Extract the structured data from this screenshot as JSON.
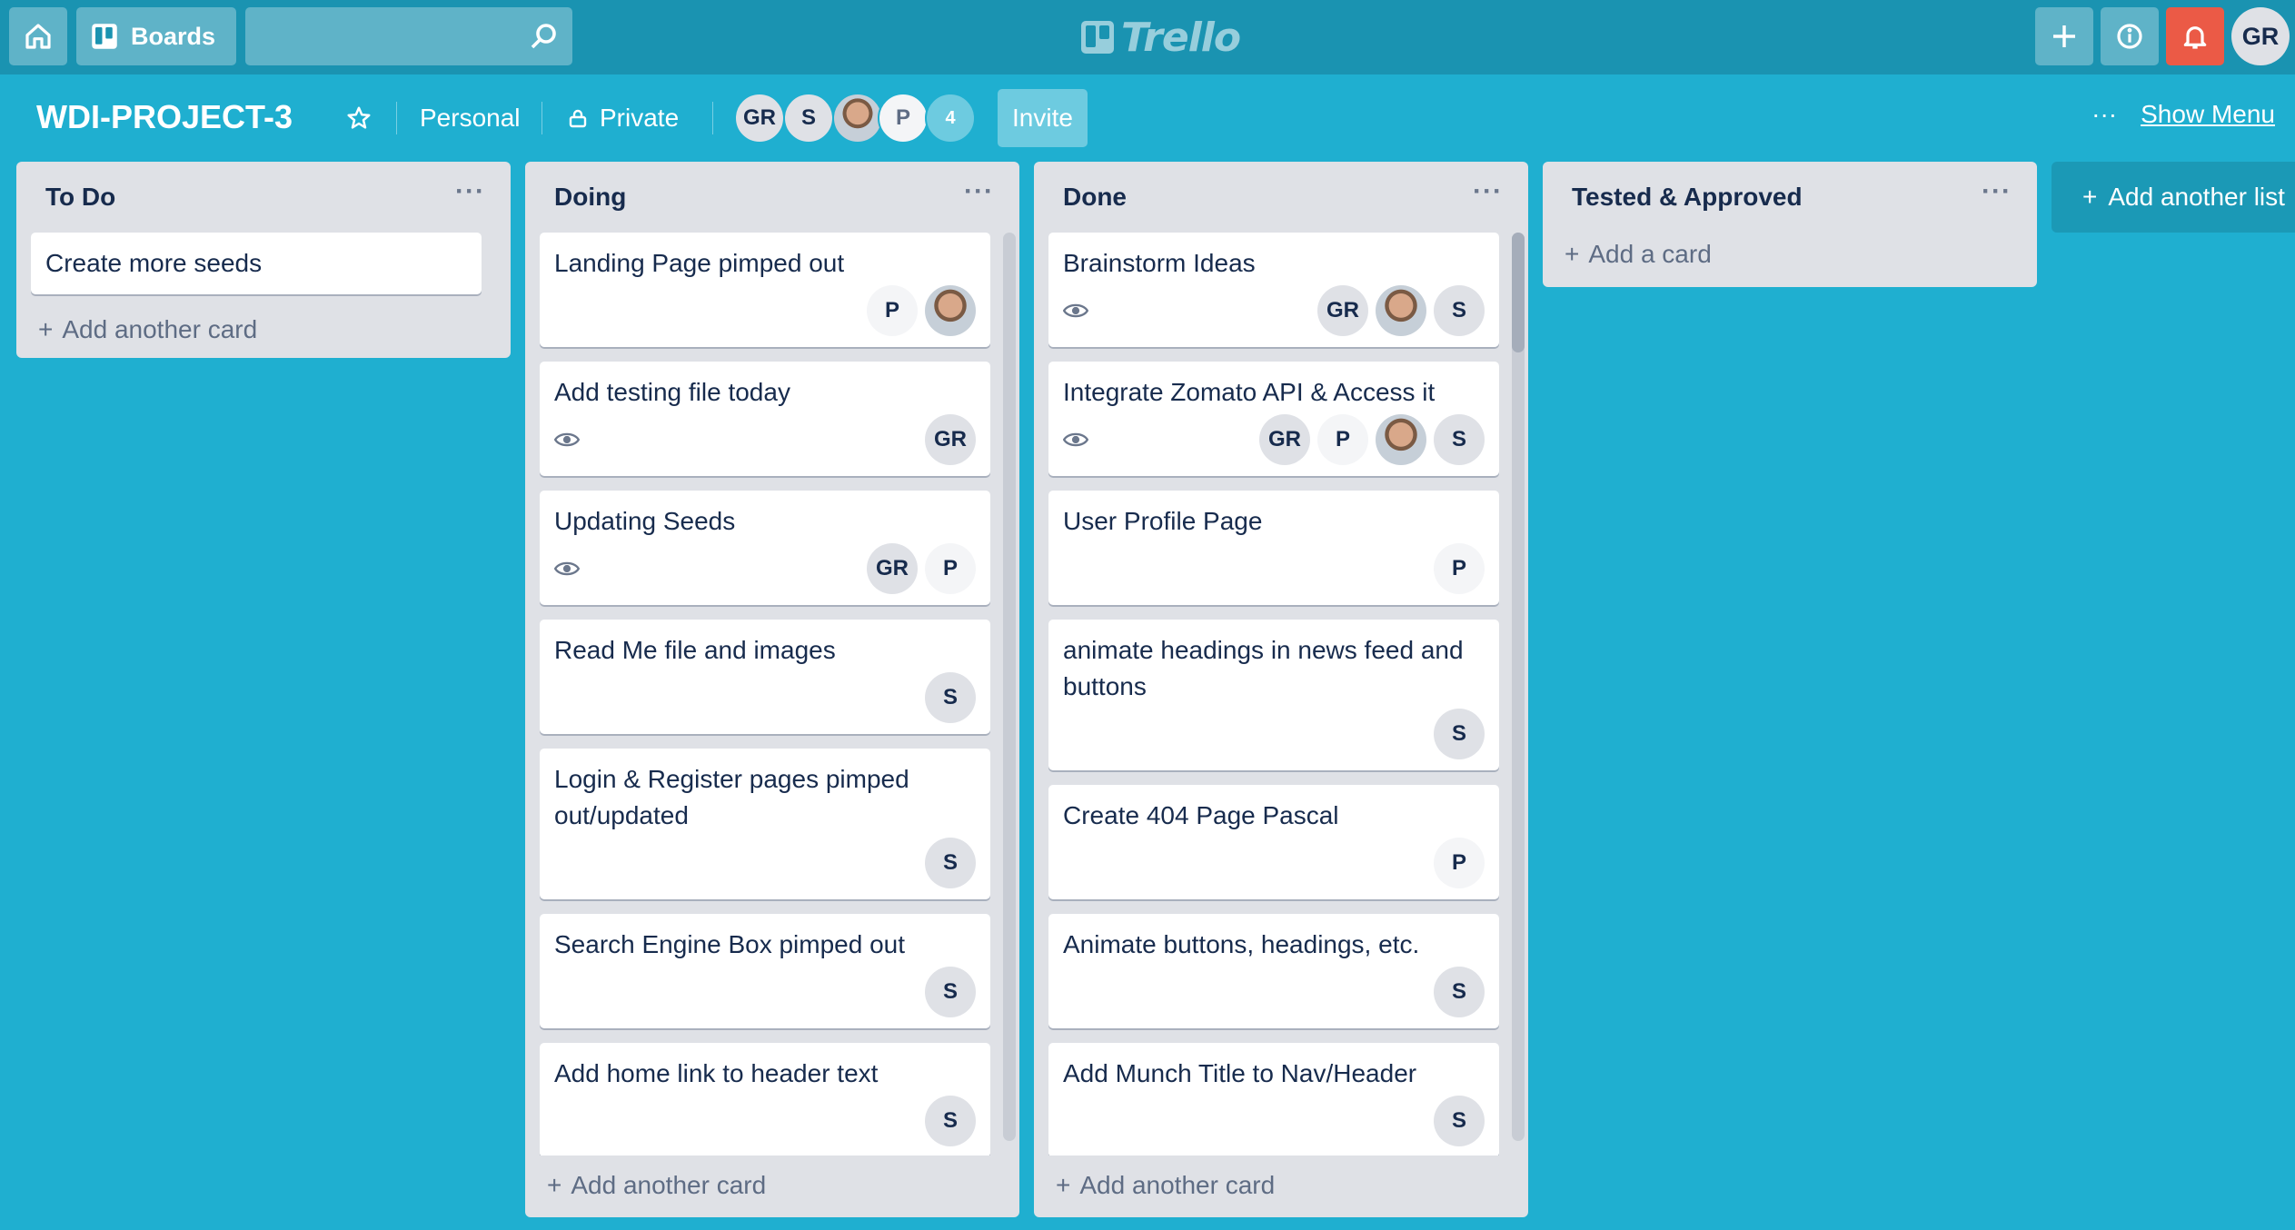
{
  "topbar": {
    "home_icon": "home-icon",
    "boards_label": "Boards",
    "search_placeholder": "",
    "logo_text": "Trello",
    "user_initials": "GR"
  },
  "board": {
    "title": "WDI-PROJECT-3",
    "team_label": "Personal",
    "visibility_label": "Private",
    "members": [
      "GR",
      "S",
      "",
      "P"
    ],
    "extra_members": "4",
    "invite_label": "Invite",
    "show_menu_label": "Show Menu"
  },
  "lists": [
    {
      "title": "To Do",
      "add_label": "Add another card",
      "cards": [
        {
          "title": "Create more seeds"
        }
      ]
    },
    {
      "title": "Doing",
      "add_label": "Add another card",
      "cards": [
        {
          "title": "Landing Page pimped out",
          "members": [
            "P",
            "photo"
          ]
        },
        {
          "title": "Add testing file today",
          "watch": true,
          "members": [
            "GR"
          ]
        },
        {
          "title": "Updating Seeds",
          "watch": true,
          "members": [
            "GR",
            "P"
          ]
        },
        {
          "title": "Read Me file and images",
          "members": [
            "S"
          ]
        },
        {
          "title": "Login & Register pages pimped out/updated",
          "members": [
            "S"
          ]
        },
        {
          "title": "Search Engine Box pimped out",
          "members": [
            "S"
          ]
        },
        {
          "title": "Add home link to header text",
          "members": [
            "S"
          ]
        }
      ]
    },
    {
      "title": "Done",
      "add_label": "Add another card",
      "cards": [
        {
          "title": "Brainstorm Ideas",
          "watch": true,
          "members": [
            "GR",
            "photo",
            "S"
          ]
        },
        {
          "title": "Integrate Zomato API & Access it",
          "watch": true,
          "members": [
            "GR",
            "P",
            "photo",
            "S"
          ]
        },
        {
          "title": "User Profile Page",
          "members": [
            "P"
          ]
        },
        {
          "title": "animate headings in news feed and buttons",
          "members": [
            "S"
          ]
        },
        {
          "title": "Create 404 Page Pascal",
          "members": [
            "P"
          ]
        },
        {
          "title": "Animate buttons, headings, etc.",
          "members": [
            "S"
          ]
        },
        {
          "title": "Add Munch Title to Nav/Header",
          "members": [
            "S"
          ]
        }
      ]
    },
    {
      "title": "Tested & Approved",
      "add_label": "Add a card",
      "cards": []
    }
  ],
  "add_list_label": "Add another list",
  "colors": {
    "board_bg": "#1fafd0",
    "header_bg": "#1a93b1",
    "bell_bg": "#eb5a46",
    "list_bg": "#dfe1e6"
  }
}
